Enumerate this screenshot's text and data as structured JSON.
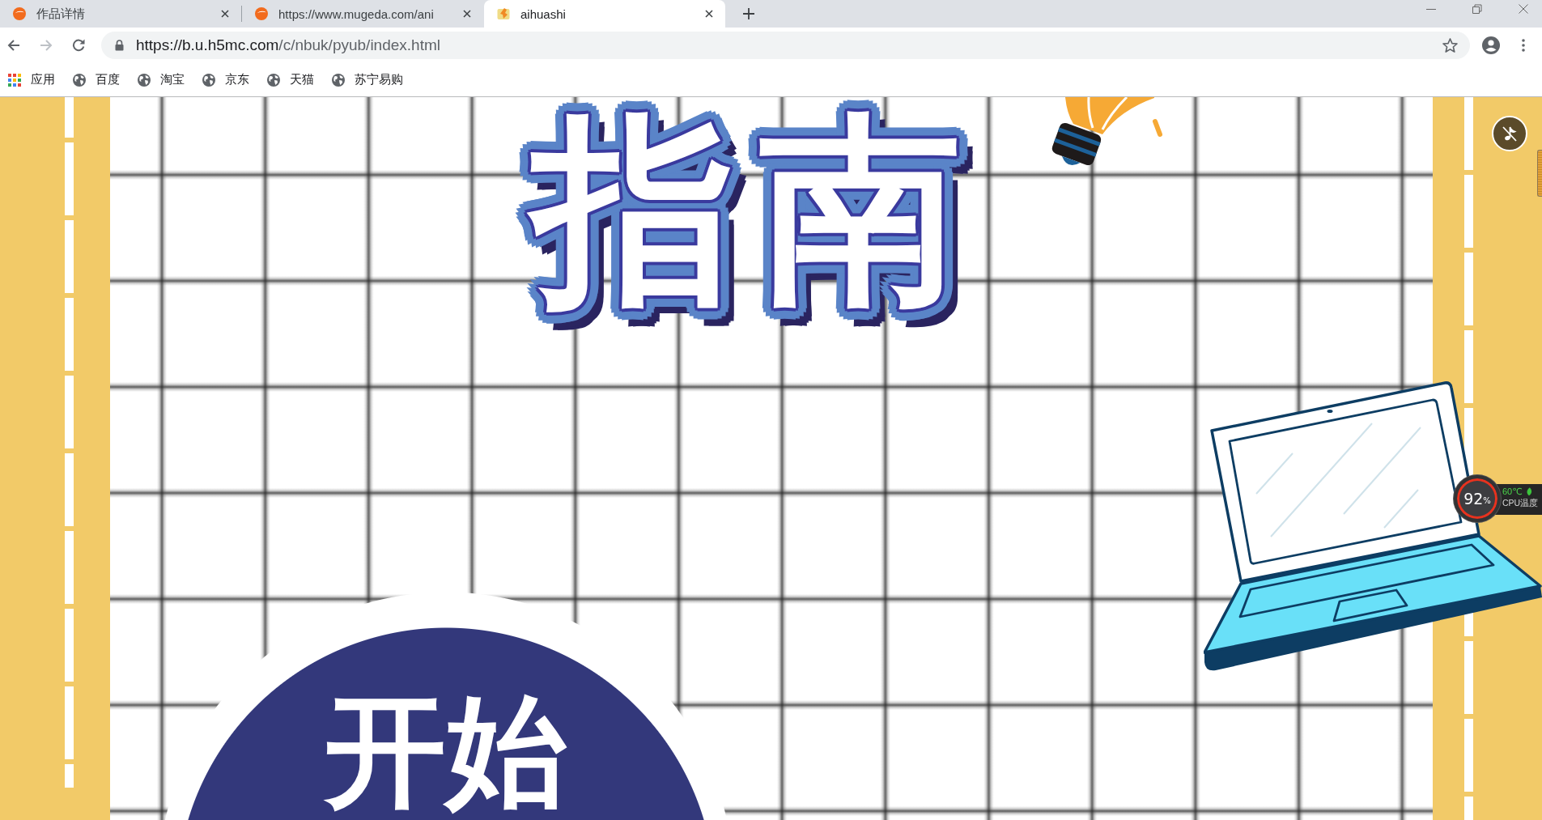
{
  "tabs": [
    {
      "title": "作品详情",
      "kind": "disc",
      "selected": false
    },
    {
      "title": "https://www.mugeda.com/ani",
      "kind": "disc",
      "selected": false
    },
    {
      "title": "aihuashi",
      "kind": "sticker",
      "selected": true
    }
  ],
  "toolbar": {
    "nav_buttons": [
      {
        "kind": "back",
        "disabled": false
      },
      {
        "kind": "forward",
        "disabled": true
      },
      {
        "kind": "reload",
        "disabled": false
      }
    ],
    "url": {
      "host": "https://b.u.h5mc.com",
      "path": "/c/nbuk/pyub/index.html"
    },
    "bookmarked": false
  },
  "bookmarks": [
    {
      "label": "应用",
      "kind": "apps"
    },
    {
      "label": "百度",
      "kind": "globe"
    },
    {
      "label": "淘宝",
      "kind": "globe"
    },
    {
      "label": "京东",
      "kind": "globe"
    },
    {
      "label": "天猫",
      "kind": "globe"
    },
    {
      "label": "苏宁易购",
      "kind": "globe"
    }
  ],
  "page": {
    "title_art": "指南",
    "start_button": "开始",
    "music_muted": true
  },
  "cpu_monitor": {
    "usage": "92",
    "unit": "%",
    "temperature": "60℃",
    "label": "CPU温度"
  }
}
